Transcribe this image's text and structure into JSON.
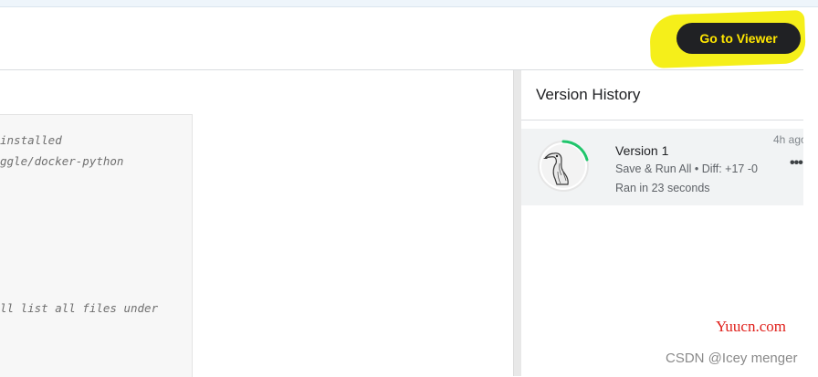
{
  "header": {
    "go_to_viewer_label": "Go to Viewer",
    "highlight_color": "#f5ef1a"
  },
  "editor": {
    "code_lines": [
      "installed",
      "ggle/docker-python",
      "ll list all files under"
    ]
  },
  "version_history": {
    "title": "Version History",
    "versions": [
      {
        "name": "Version 1",
        "meta": "Save & Run All • Diff: +17 -0",
        "status": "Ran in 23 seconds",
        "time": "4h ago",
        "avatar_icon": "goose-avatar-icon",
        "progress_color": "#20c56b"
      }
    ],
    "more_label": "•••"
  },
  "watermarks": {
    "site": "Yuucn.com",
    "author": "CSDN @Icey menger"
  },
  "colors": {
    "button_bg": "#202124",
    "button_text": "#ffe600",
    "site_watermark": "#e0201b"
  }
}
